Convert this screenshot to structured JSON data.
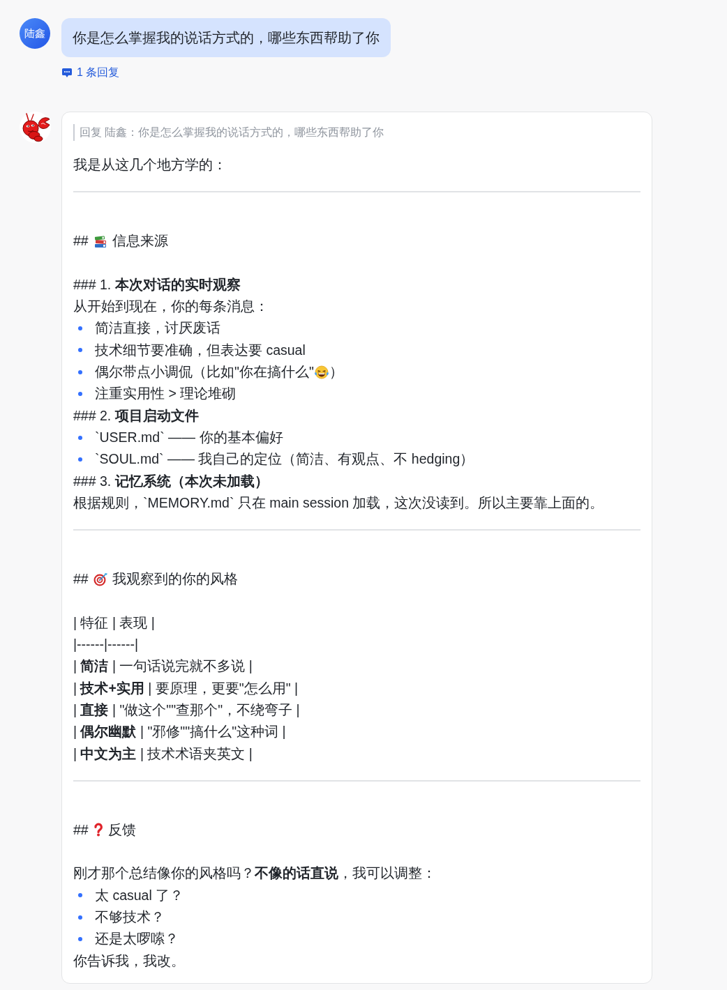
{
  "user_message": {
    "avatar": "陆鑫",
    "text": "你是怎么掌握我的说话方式的，哪些东西帮助了你",
    "reply_link": "1 条回复"
  },
  "bot_message": {
    "quote": "回复 陆鑫：你是怎么掌握我的说话方式的，哪些东西帮助了你",
    "blocks": [
      {
        "kind": "line",
        "text": "我是从这几个地方学的："
      },
      {
        "kind": "rule"
      },
      {
        "kind": "heading",
        "marker": "##",
        "text": "信息来源"
      },
      {
        "kind": "line",
        "text": "### 1. **本次对话的实时观察**"
      },
      {
        "kind": "line",
        "text": "从开始到现在，你的每条消息："
      },
      {
        "kind": "list",
        "items": [
          {
            "text": "简洁直接，讨厌废话"
          },
          {
            "text": "技术细节要准确，但表达要 casual"
          },
          {
            "text": "偶尔带点小调侃（比如\"你在搞什么\"",
            "tail": "）"
          },
          {
            "text": "注重实用性 > 理论堆砌"
          }
        ]
      },
      {
        "kind": "line",
        "text": "### 2. **项目启动文件**"
      },
      {
        "kind": "list",
        "items": [
          {
            "text": "`USER.md` —— 你的基本偏好"
          },
          {
            "text": "`SOUL.md` —— 我自己的定位（简洁、有观点、不 hedging）"
          }
        ]
      },
      {
        "kind": "line",
        "text": "### 3. **记忆系统（本次未加载）**"
      },
      {
        "kind": "line",
        "text": "根据规则，`MEMORY.md` 只在 main session 加载，这次没读到。所以主要靠上面的。"
      },
      {
        "kind": "rule"
      },
      {
        "kind": "heading",
        "marker": "##",
        "text": "我观察到的你的风格"
      },
      {
        "kind": "line",
        "text": "| 特征 | 表现 |"
      },
      {
        "kind": "line",
        "text": "|------|------|"
      },
      {
        "kind": "line",
        "text": "| **简洁** | 一句话说完就不多说 |"
      },
      {
        "kind": "line",
        "text": "| **技术+实用** | 要原理，更要\"怎么用\" |"
      },
      {
        "kind": "line",
        "text": "| **直接** | \"做这个\"\"查那个\"，不绕弯子 |"
      },
      {
        "kind": "line",
        "text": "| **偶尔幽默** | \"邪修\"\"搞什么\"这种词 |"
      },
      {
        "kind": "line",
        "text": "| **中文为主** | 技术术语夹英文 |"
      },
      {
        "kind": "rule"
      },
      {
        "kind": "heading",
        "marker": "##",
        "text": "反馈"
      },
      {
        "kind": "line",
        "text": "刚才那个总结像你的风格吗？**不像的话直说**，我可以调整："
      },
      {
        "kind": "list",
        "items": [
          {
            "text": "太 casual 了？"
          },
          {
            "text": "不够技术？"
          },
          {
            "text": "还是太啰嗦？"
          }
        ]
      },
      {
        "kind": "line",
        "text": "你告诉我，我改。"
      }
    ]
  }
}
